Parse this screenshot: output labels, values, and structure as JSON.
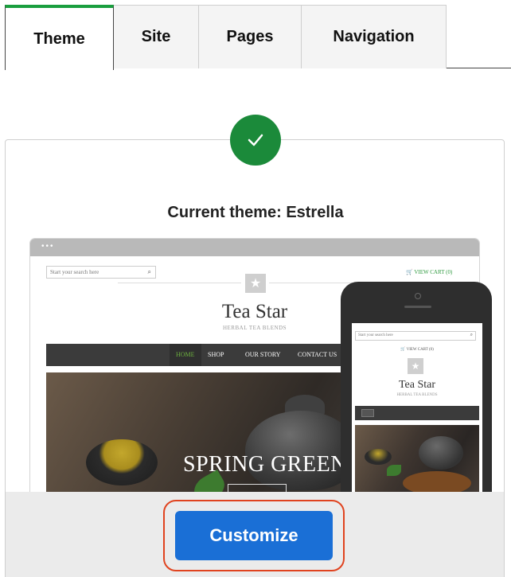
{
  "tabs": [
    {
      "label": "Theme",
      "active": true
    },
    {
      "label": "Site",
      "active": false
    },
    {
      "label": "Pages",
      "active": false
    },
    {
      "label": "Navigation",
      "active": false
    }
  ],
  "current_theme_label": "Current theme: Estrella",
  "status_icon": "check-icon",
  "colors": {
    "accent_green": "#1b8a3a",
    "tab_active_border": "#1a9e3e",
    "primary_button": "#1a6fd6",
    "highlight_ring": "#e0431f"
  },
  "preview": {
    "desktop": {
      "search_placeholder": "Start your search here",
      "cart": "VIEW CART (0)",
      "site_title": "Tea Star",
      "site_subtitle": "HERBAL TEA BLENDS",
      "nav": [
        "HOME",
        "SHOP",
        "OUR STORY",
        "CONTACT US"
      ],
      "hero_text": "SPRING GREEN"
    },
    "mobile": {
      "search_placeholder": "Start your search here",
      "cart": "VIEW CART (0)",
      "site_title": "Tea Star",
      "site_subtitle": "HERBAL TEA BLENDS"
    }
  },
  "customize_button": "Customize"
}
